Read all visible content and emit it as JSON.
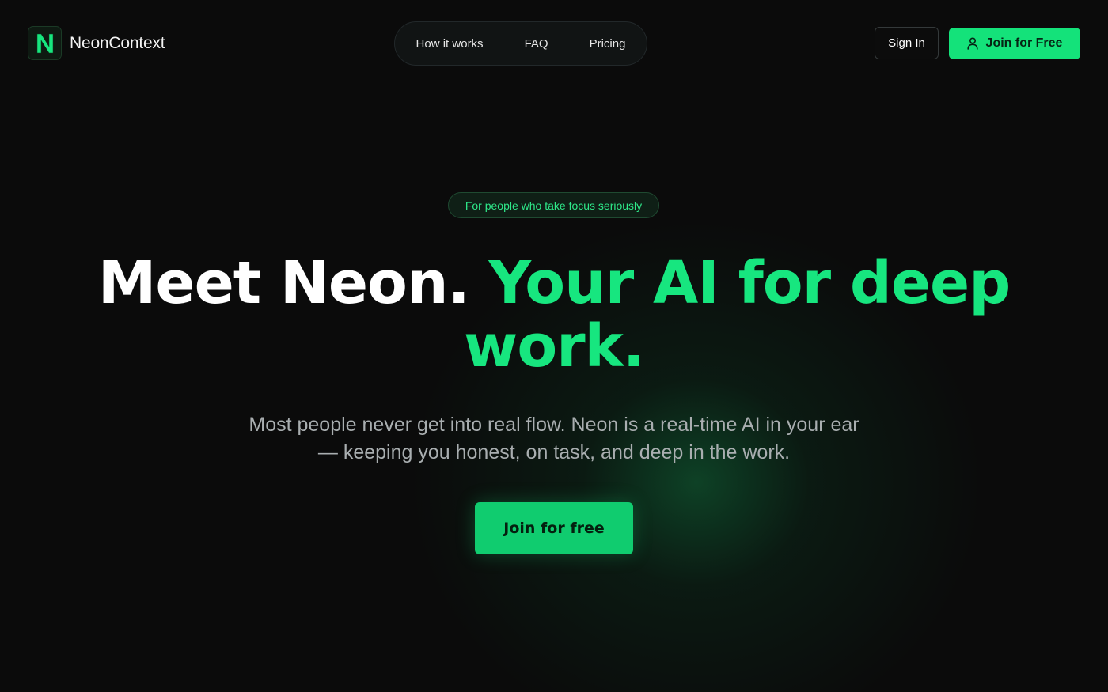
{
  "header": {
    "brand": {
      "logo_letter": "N",
      "name": "NeonContext"
    },
    "nav": [
      {
        "label": "How it works"
      },
      {
        "label": "FAQ"
      },
      {
        "label": "Pricing"
      }
    ],
    "sign_in_label": "Sign In",
    "join_label": "Join for Free",
    "join_icon": "user-icon"
  },
  "hero": {
    "badge": "For people who take focus seriously",
    "title_part1": "Meet Neon.",
    "title_part2": "Your AI for deep work.",
    "subtitle": "Most people never get into real flow. Neon is a real-time AI in your ear — keeping you honest, on task, and deep in the work.",
    "cta_label": "Join for free"
  },
  "colors": {
    "background": "#0b0b0b",
    "accent": "#17e67f",
    "button_primary": "#14e27a",
    "muted_text": "#a9aeb0"
  }
}
